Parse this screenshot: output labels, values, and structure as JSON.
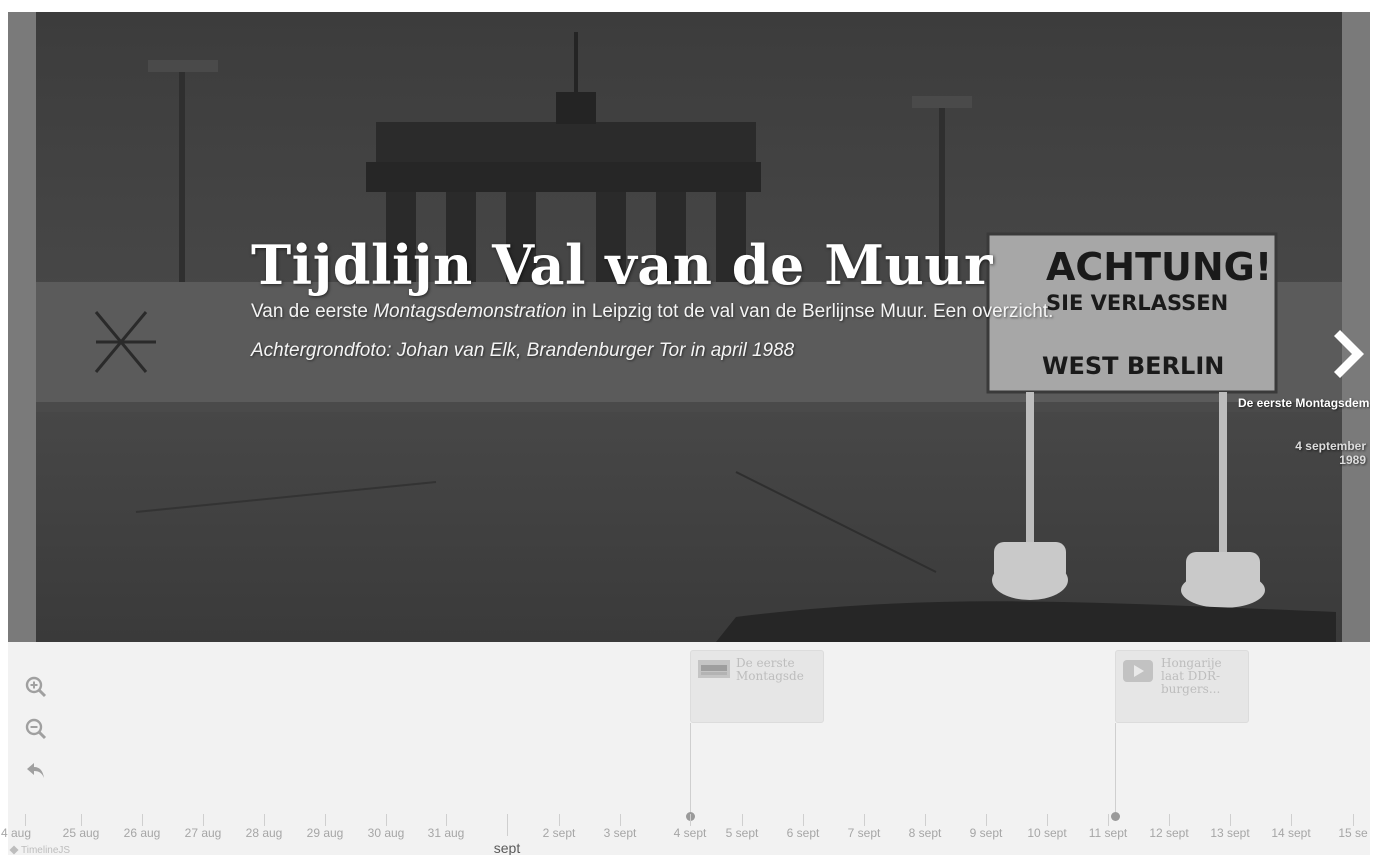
{
  "slide": {
    "headline": "Tijdlijn Val van de Muur",
    "desc_before": "Van de eerste ",
    "desc_italic": "Montagsdemonstration",
    "desc_after": " in Leipzig tot de val van de Berlijnse Muur. Een overzicht.",
    "credit": "Achtergrondfoto: Johan van Elk, Brandenburger Tor in april 1988",
    "photo_sign_text": [
      "ACHTUNG!",
      "SIE VERLASSEN",
      "WEST BERLIN"
    ]
  },
  "nav_next": {
    "title": "De eerste Montagsdemon",
    "date_line1": "4 september",
    "date_line2": "1989",
    "icon": "chevron-right-icon"
  },
  "zoom": {
    "zoom_in_icon": "zoom-in-icon",
    "zoom_out_icon": "zoom-out-icon",
    "back_icon": "back-to-start-icon"
  },
  "markers": [
    {
      "text": "De eerste Montagsde",
      "icon": "image-thumbnail-icon"
    },
    {
      "text": "Hongarije laat DDR-burgers...",
      "icon": "video-play-icon"
    }
  ],
  "axis": {
    "ticks": [
      "4 aug",
      "25 aug",
      "26 aug",
      "27 aug",
      "28 aug",
      "29 aug",
      "30 aug",
      "31 aug",
      "2 sept",
      "3 sept",
      "4 sept",
      "5 sept",
      "6 sept",
      "7 sept",
      "8 sept",
      "9 sept",
      "10 sept",
      "11 sept",
      "12 sept",
      "13 sept",
      "14 sept",
      "15 se"
    ],
    "major": "sept"
  },
  "brand": "TimelineJS",
  "colors": {
    "slide_bg": "#7a7a7a",
    "timenav_bg": "#f2f2f2",
    "marker_bg": "#e6e6e6"
  }
}
